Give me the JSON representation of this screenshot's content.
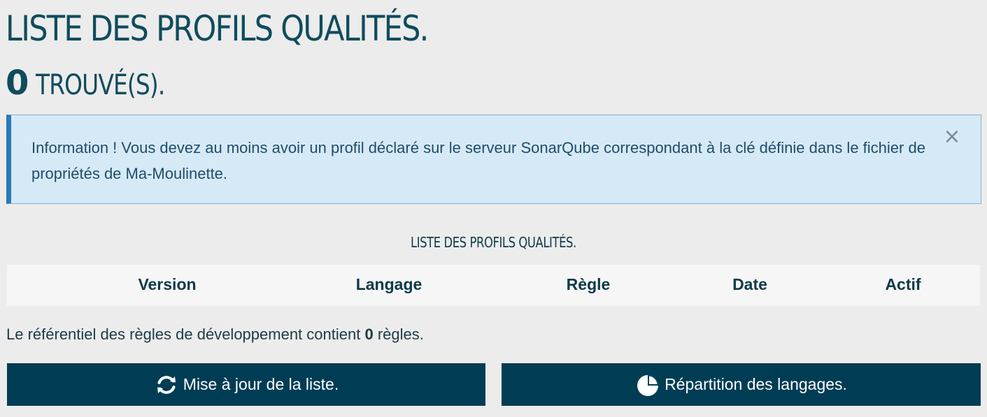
{
  "header": {
    "title": "LISTE DES PROFILS QUALITÉS.",
    "found_count": "0",
    "found_label": "TROUVÉ(S)."
  },
  "alert": {
    "message": "Information ! Vous devez au moins avoir un profil déclaré sur le serveur SonarQube correspondant à la clé définie dans le fichier de propriétés de Ma-Moulinette.",
    "close_glyph": "×",
    "close_icon": "close-icon"
  },
  "table": {
    "caption": "LISTE DES PROFILS QUALITÉS.",
    "columns": [
      "Version",
      "Langage",
      "Règle",
      "Date",
      "Actif"
    ],
    "rows": []
  },
  "summary": {
    "prefix": "Le référentiel des règles de développement contient",
    "count": "0",
    "suffix": "règles."
  },
  "buttons": {
    "update_label": "Mise à jour de la liste.",
    "update_icon": "refresh-icon",
    "languages_label": "Répartition des langages.",
    "languages_icon": "pie-chart-icon"
  },
  "colors": {
    "background": "#ececec",
    "title": "#0f4c5c",
    "alert_bg": "#d6e9f6",
    "alert_accent": "#2a7ab6",
    "button_bg": "#003d55",
    "header_row_bg": "#f6f6f6"
  }
}
